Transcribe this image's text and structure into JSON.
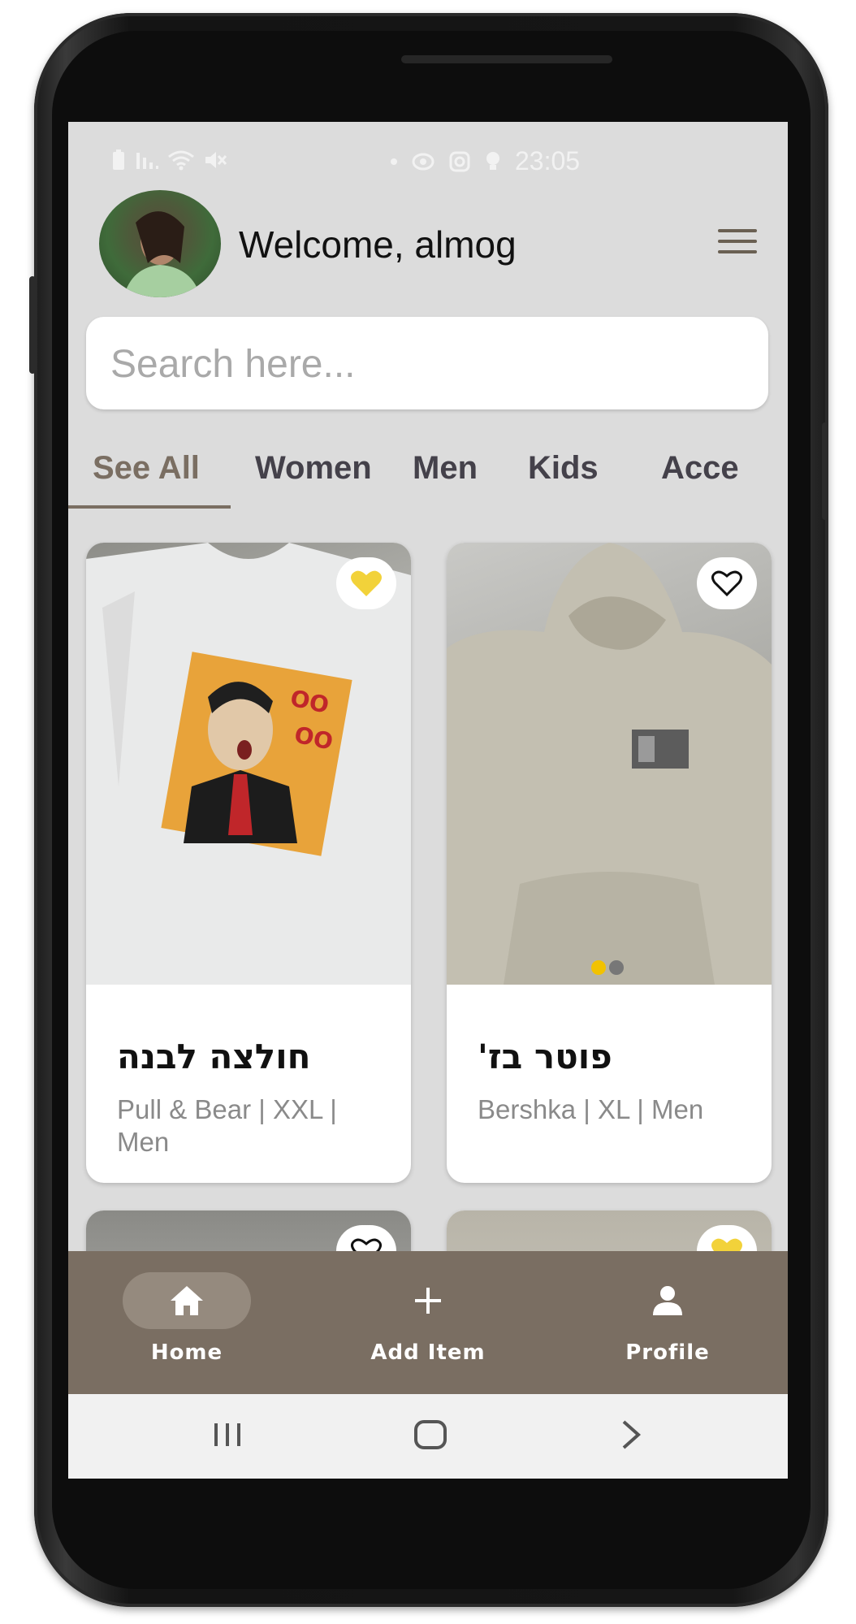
{
  "status_bar": {
    "time": "23:05"
  },
  "header": {
    "welcome_text": "Welcome, almog"
  },
  "search": {
    "placeholder": "Search here..."
  },
  "tabs": [
    {
      "label": "See All",
      "active": true
    },
    {
      "label": "Women",
      "active": false
    },
    {
      "label": "Men",
      "active": false
    },
    {
      "label": "Kids",
      "active": false
    },
    {
      "label": "Acce",
      "active": false
    }
  ],
  "items": [
    {
      "title": "חולצה לבנה",
      "subtitle": "Pull &  Bear | XXL | Men",
      "favorited": true,
      "image_dots": null
    },
    {
      "title": "פוטר בז'",
      "subtitle": "Bershka | XL | Men",
      "favorited": false,
      "image_dots": {
        "count": 2,
        "active": 0
      }
    },
    {
      "favorited": false
    },
    {
      "favorited": true
    }
  ],
  "bottom_nav": [
    {
      "label": "Home",
      "icon": "home-icon",
      "active": true
    },
    {
      "label": "Add Item",
      "icon": "plus-icon",
      "active": false
    },
    {
      "label": "Profile",
      "icon": "person-icon",
      "active": false
    }
  ],
  "colors": {
    "accent": "#7a6e62",
    "favorite": "#f2d23a",
    "screen_bg": "#dcdcdc"
  }
}
